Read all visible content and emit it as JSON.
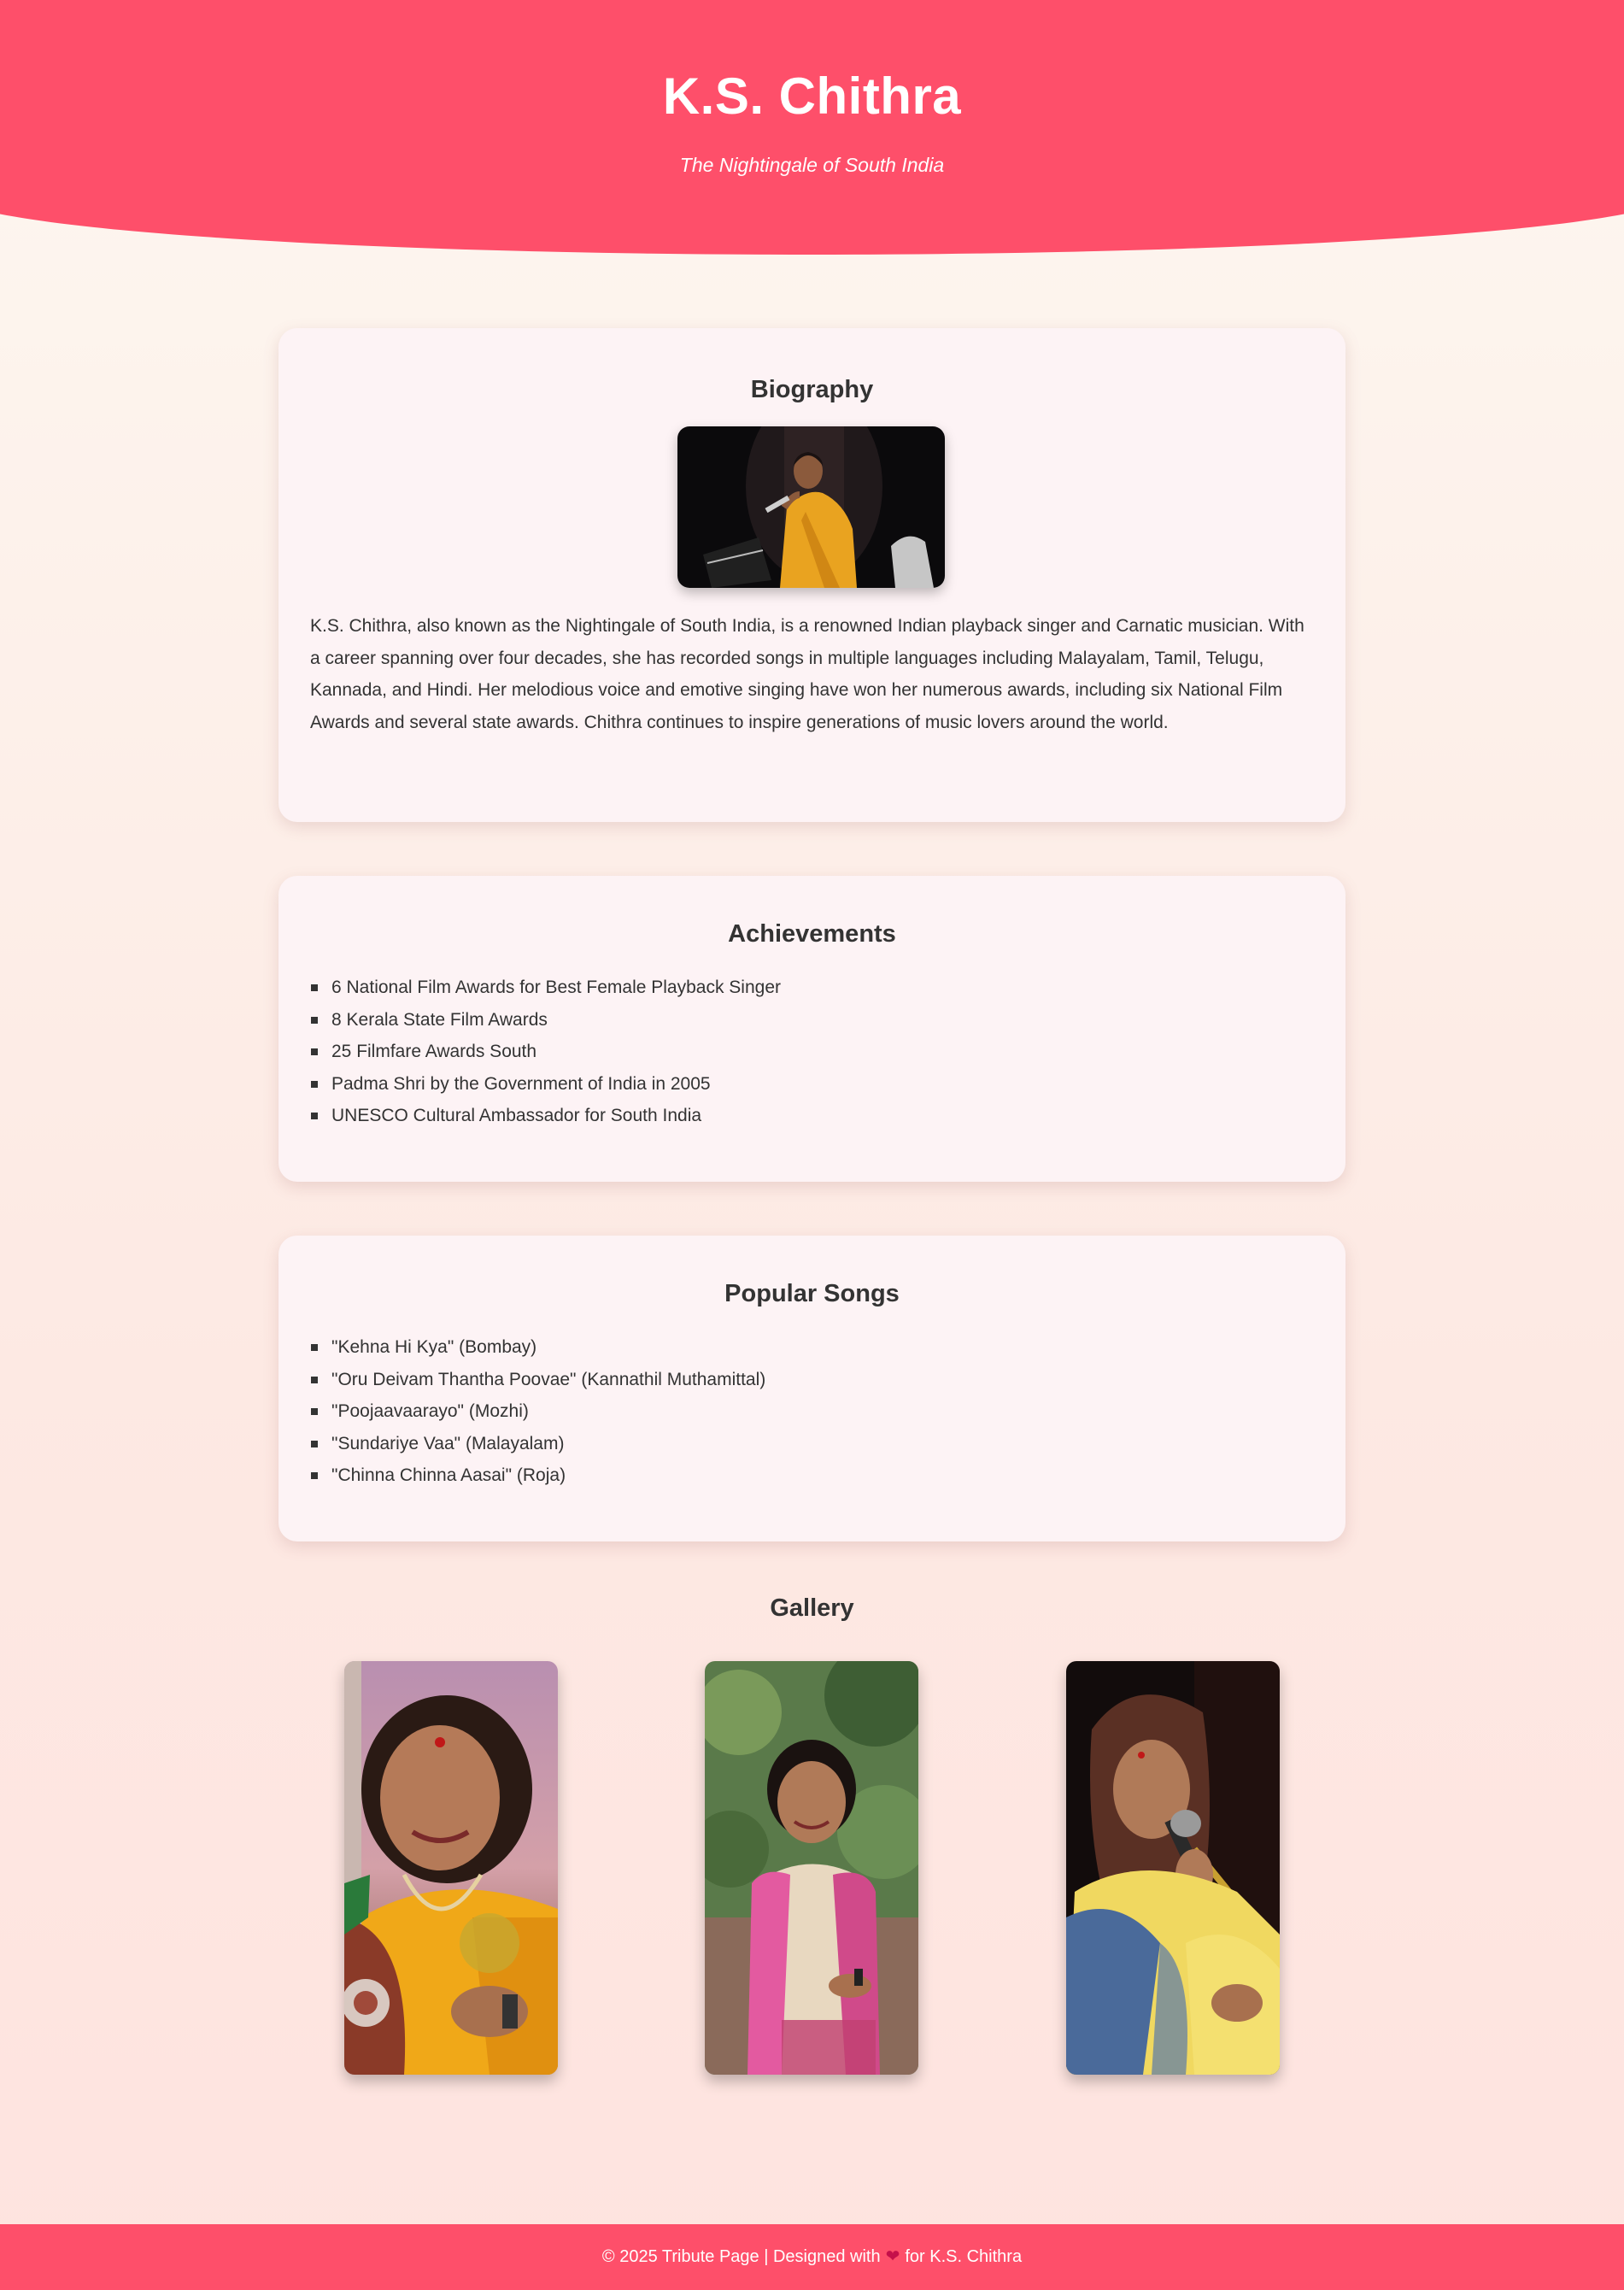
{
  "header": {
    "title": "K.S. Chithra",
    "subtitle": "The Nightingale of South India"
  },
  "biography": {
    "heading": "Biography",
    "text": "K.S. Chithra, also known as the Nightingale of South India, is a renowned Indian playback singer and Carnatic musician. With a career spanning over four decades, she has recorded songs in multiple languages including Malayalam, Tamil, Telugu, Kannada, and Hindi. Her melodious voice and emotive singing have won her numerous awards, including six National Film Awards and several state awards. Chithra continues to inspire generations of music lovers around the world."
  },
  "achievements": {
    "heading": "Achievements",
    "items": [
      "6 National Film Awards for Best Female Playback Singer",
      "8 Kerala State Film Awards",
      "25 Filmfare Awards South",
      "Padma Shri by the Government of India in 2005",
      "UNESCO Cultural Ambassador for South India"
    ]
  },
  "songs": {
    "heading": "Popular Songs",
    "items": [
      "\"Kehna Hi Kya\" (Bombay)",
      "\"Oru Deivam Thantha Poovae\" (Kannathil Muthamittal)",
      "\"Poojaavaarayo\" (Mozhi)",
      "\"Sundariye Vaa\" (Malayalam)",
      "\"Chinna Chinna Aasai\" (Roja)"
    ]
  },
  "gallery": {
    "heading": "Gallery"
  },
  "footer": {
    "text_before": "© 2025 Tribute Page | Designed with",
    "heart": "❤",
    "text_after": "for K.S. Chithra"
  },
  "colors": {
    "accent": "#fe4f6a",
    "card_bg": "#fdf3f5",
    "text": "#333333"
  },
  "icons": {
    "heart": "heart-icon"
  }
}
